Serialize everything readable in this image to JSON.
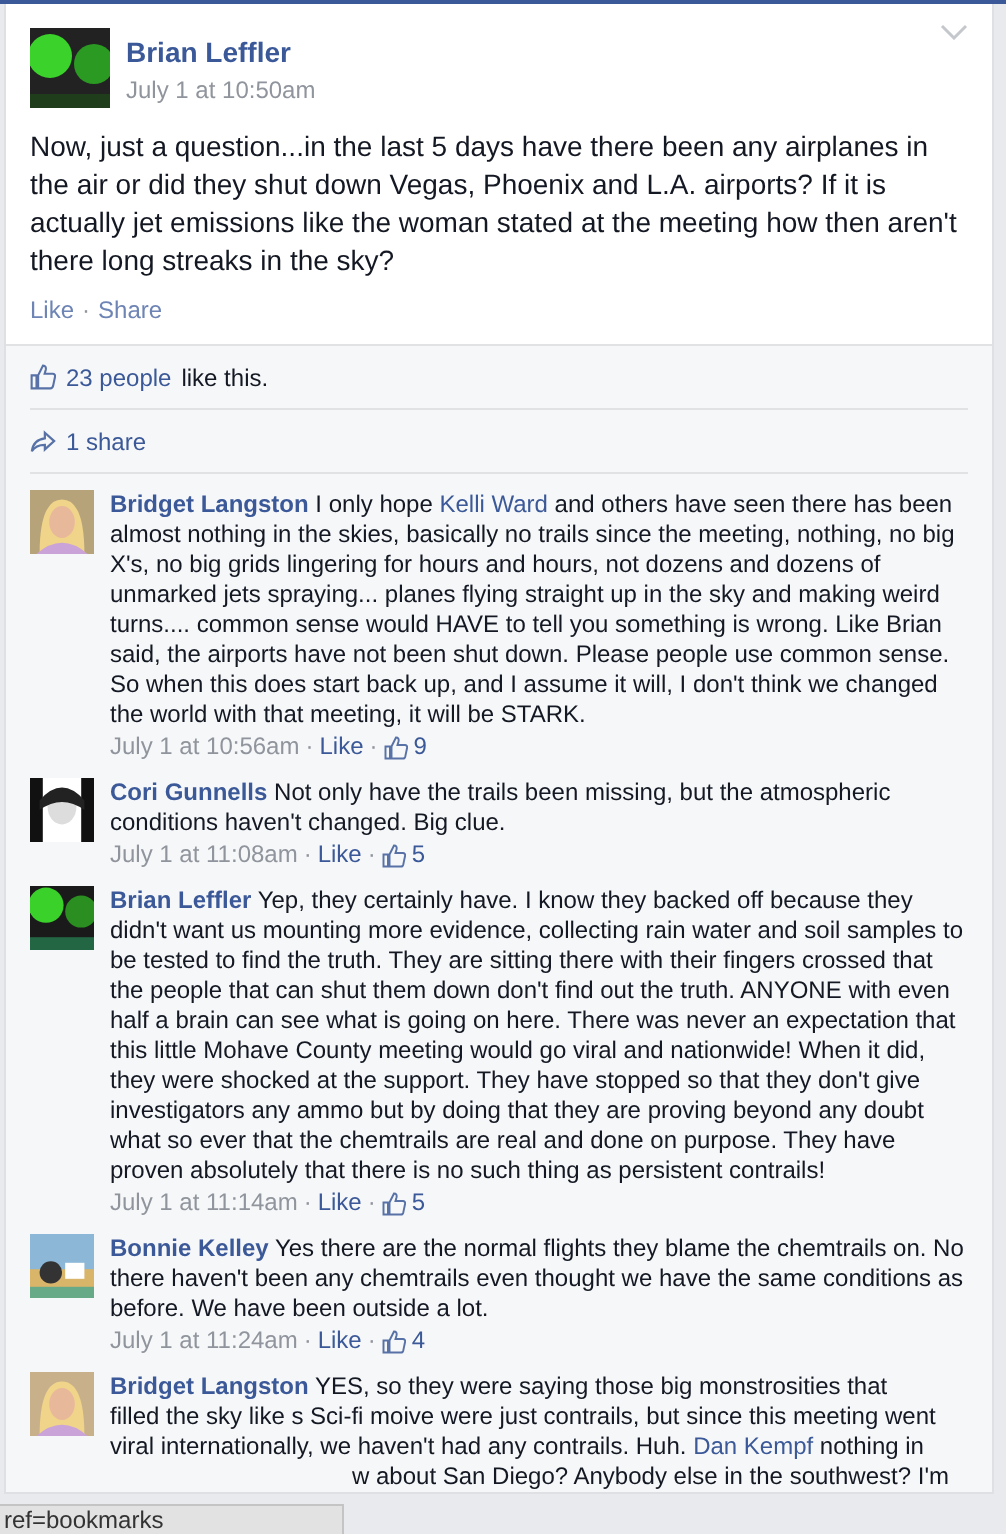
{
  "post": {
    "author": "Brian Leffler",
    "time": "July 1 at 10:50am",
    "text": "Now, just a question...in the last 5 days have there been any airplanes in the air or did they shut down Vegas, Phoenix and L.A. airports? If it is actually jet emissions like the woman stated at the meeting how then aren't there long streaks in the sky?",
    "actions": [
      "Like",
      "Share"
    ]
  },
  "separator": "·",
  "likes_summary": {
    "count_link": "23 people",
    "rest": "like this."
  },
  "shares": "1 share",
  "comments": [
    {
      "author": "Bridget Langston",
      "segments": [
        {
          "kind": "text",
          "text": "I only hope "
        },
        {
          "kind": "link",
          "text": "Kelli Ward"
        },
        {
          "kind": "text",
          "text": " and others have seen there has been almost nothing in the skies, basically no trails since the meeting, nothing, no big X's, no big grids lingering for hours and hours, not dozens and dozens of unmarked jets spraying... planes flying straight up in the sky and making weird turns.... common sense would HAVE to tell you something is wrong. Like Brian said, the airports have not been shut down. Please people use common sense. So when this does start back up, and I assume it will, I don't think we changed the world with that meeting, it will be STARK."
        }
      ],
      "time": "July 1 at 10:56am",
      "like": "Like",
      "likes": "9"
    },
    {
      "author": "Cori Gunnells",
      "segments": [
        {
          "kind": "text",
          "text": "Not only have the trails been missing, but the atmospheric conditions haven't changed. Big clue."
        }
      ],
      "time": "July 1 at 11:08am",
      "like": "Like",
      "likes": "5"
    },
    {
      "author": "Brian Leffler",
      "segments": [
        {
          "kind": "text",
          "text": "Yep, they certainly have. I know they backed off because they didn't want us mounting more evidence, collecting rain water and soil samples to be tested to find the truth. They are sitting there with their fingers crossed that the people that can shut them down don't find out the truth. ANYONE with even half a brain can see what is going on here. There was never an expectation that this little Mohave County meeting would go viral and nationwide! When it did, they were shocked at the support. They have stopped so that they don't give investigators any ammo but by doing that they are proving beyond any doubt what so ever that the chemtrails are real and done on purpose. They have proven absolutely that there is no such thing as persistent contrails!"
        }
      ],
      "time": "July 1 at 11:14am",
      "like": "Like",
      "likes": "5"
    },
    {
      "author": "Bonnie Kelley",
      "segments": [
        {
          "kind": "text",
          "text": "Yes there are the normal flights they blame the chemtrails on. No there haven't been any chemtrails even thought we have the same conditions as before. We have been outside a lot."
        }
      ],
      "time": "July 1 at 11:24am",
      "like": "Like",
      "likes": "4"
    },
    {
      "author": "Bridget Langston",
      "lines": [
        [
          {
            "kind": "text",
            "text": "YES, so they were saying those big monstrosities that"
          }
        ],
        [
          {
            "kind": "text",
            "text": "filled the sky like s Sci-fi moive were just contrails, but since this meeting went"
          }
        ],
        [
          {
            "kind": "text",
            "text": "viral internationally, we haven't had any contrails. Huh. "
          },
          {
            "kind": "link",
            "text": "Dan Kempf"
          },
          {
            "kind": "text",
            "text": " nothing in"
          }
        ]
      ],
      "cut_line": "w about San Diego? Anybody else in the southwest? I'm"
    }
  ],
  "status_bar": "ref=bookmarks"
}
